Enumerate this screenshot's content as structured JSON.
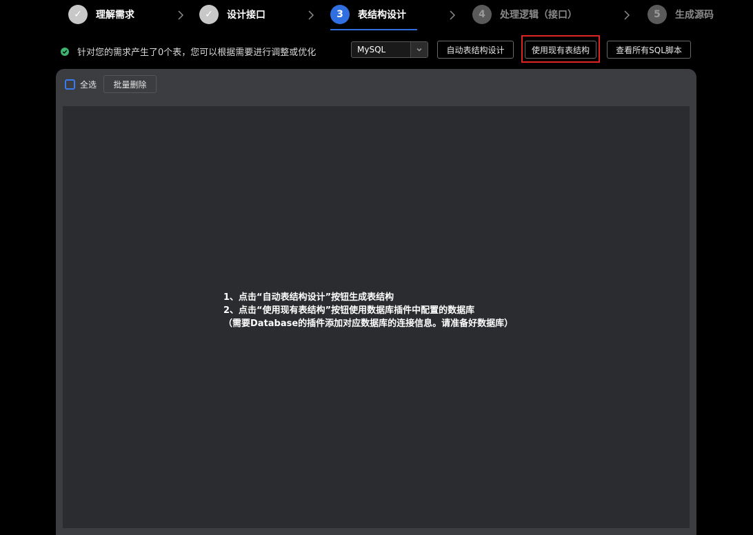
{
  "stepper": {
    "steps": [
      {
        "number": "1",
        "label": "理解需求",
        "state": "done"
      },
      {
        "number": "2",
        "label": "设计接口",
        "state": "done"
      },
      {
        "number": "3",
        "label": "表结构设计",
        "state": "active"
      },
      {
        "number": "4",
        "label": "处理逻辑（接口）",
        "state": "todo"
      },
      {
        "number": "5",
        "label": "生成源码",
        "state": "todo"
      }
    ],
    "check_glyph": "✓",
    "separator_icon": "chevron-right-icon"
  },
  "toolbar": {
    "status_text": "针对您的需求产生了0个表，您可以根据需要进行调整或优化",
    "db_select_value": "MySQL",
    "auto_design_label": "自动表结构设计",
    "use_existing_label": "使用现有表结构",
    "view_sql_label": "查看所有SQL脚本"
  },
  "panel": {
    "select_all_label": "全选",
    "batch_delete_label": "批量删除",
    "hint_lines": [
      "1、点击“自动表结构设计”按钮生成表结构",
      "2、点击“使用现有表结构”按钮使用数据库插件中配置的数据库",
      "（需要Database的插件添加对应数据库的连接信息。请准备好数据库）"
    ]
  },
  "colors": {
    "accent": "#2f6fe0",
    "status_ok": "#3cb371",
    "highlight": "#e02424",
    "panel_bg": "#3b3d40",
    "panel_body_bg": "#2b2c2f"
  }
}
